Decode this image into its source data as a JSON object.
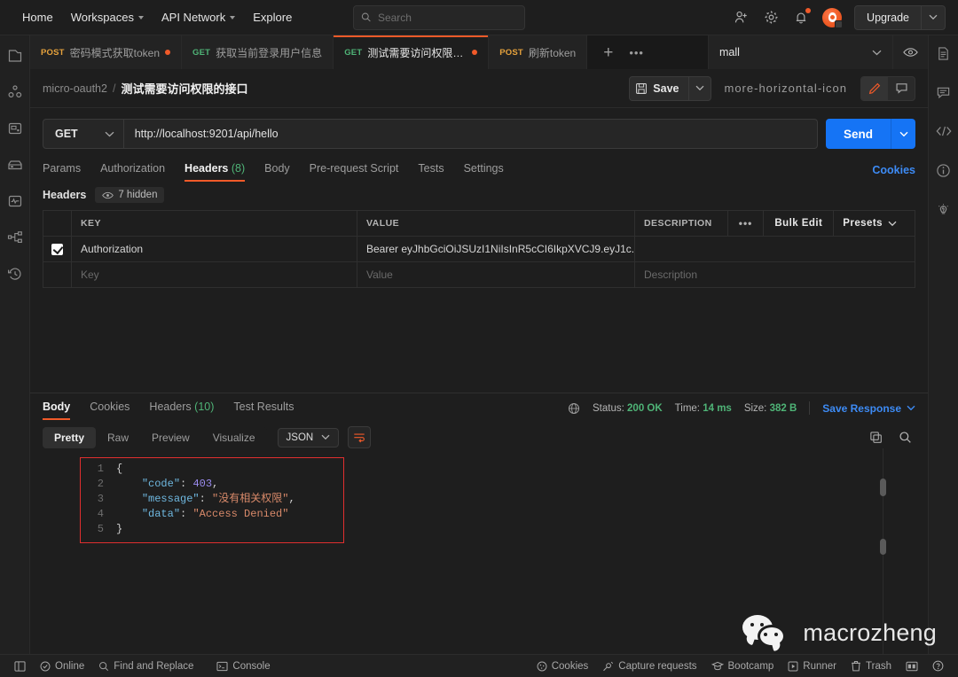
{
  "header": {
    "nav": [
      {
        "label": "Home",
        "caret": false
      },
      {
        "label": "Workspaces",
        "caret": true
      },
      {
        "label": "API Network",
        "caret": true
      },
      {
        "label": "Explore",
        "caret": false
      }
    ],
    "search": {
      "placeholder": "Search",
      "value": "",
      "icon": "search-icon"
    },
    "invite_icon": "invite-user-icon",
    "settings_icon": "gear-icon",
    "notifications_icon": "bell-icon",
    "avatar_icon": "postman-avatar-icon",
    "upgrade_label": "Upgrade"
  },
  "left_rail": [
    {
      "name": "collections-icon"
    },
    {
      "name": "apis-icon"
    },
    {
      "name": "environments-icon"
    },
    {
      "name": "mock-servers-icon"
    },
    {
      "name": "monitors-icon"
    },
    {
      "name": "flows-icon"
    },
    {
      "name": "history-icon"
    }
  ],
  "right_rail": [
    {
      "name": "documentation-icon"
    },
    {
      "name": "comments-icon"
    },
    {
      "name": "code-snippet-icon"
    },
    {
      "name": "info-icon"
    },
    {
      "name": "lightbulb-icon"
    }
  ],
  "tabs": [
    {
      "method": "POST",
      "name": "密码模式获取token",
      "unsaved": true,
      "active": false
    },
    {
      "method": "GET",
      "name": "获取当前登录用户信息",
      "unsaved": false,
      "active": false
    },
    {
      "method": "GET",
      "name": "测试需要访问权限的接口",
      "unsaved": true,
      "active": true
    },
    {
      "method": "POST",
      "name": "刷新token",
      "unsaved": false,
      "active": false
    }
  ],
  "tab_actions": {
    "new_tab": "+",
    "more": "•••"
  },
  "environment": {
    "name": "mall",
    "eye_icon": "eye-icon",
    "chevron": "chevron-down-icon"
  },
  "breadcrumb": {
    "collection": "micro-oauth2",
    "separator": "/",
    "request": "测试需要访问权限的接口"
  },
  "request_actions": {
    "save_label": "Save",
    "save_icon": "floppy-disk-icon",
    "more_icon": "more-horizontal-icon",
    "edit_icon": "pencil-icon",
    "comment_icon": "comment-icon"
  },
  "request": {
    "method": "GET",
    "url": "http://localhost:9201/api/hello",
    "send_label": "Send",
    "tabs": [
      {
        "label": "Params",
        "count": "",
        "active": false
      },
      {
        "label": "Authorization",
        "count": "",
        "active": false
      },
      {
        "label": "Headers",
        "count": "(8)",
        "active": true
      },
      {
        "label": "Body",
        "count": "",
        "active": false
      },
      {
        "label": "Pre-request Script",
        "count": "",
        "active": false
      },
      {
        "label": "Tests",
        "count": "",
        "active": false
      },
      {
        "label": "Settings",
        "count": "",
        "active": false
      }
    ],
    "cookies_link": "Cookies"
  },
  "headers_panel": {
    "title": "Headers",
    "hidden_label": "7 hidden",
    "hidden_icon": "eye-icon",
    "columns": [
      "KEY",
      "VALUE",
      "DESCRIPTION"
    ],
    "toolbar": {
      "dots": "•••",
      "bulk_edit": "Bulk Edit",
      "presets": "Presets"
    },
    "rows": [
      {
        "enabled": true,
        "key": "Authorization",
        "value": "Bearer eyJhbGciOiJSUzI1NiIsInR5cCI6IkpXVCJ9.eyJ1c...",
        "description": ""
      }
    ],
    "placeholder_row": {
      "key": "Key",
      "value": "Value",
      "description": "Description"
    }
  },
  "response": {
    "tabs": [
      {
        "label": "Body",
        "count": "",
        "active": true
      },
      {
        "label": "Cookies",
        "count": "",
        "active": false
      },
      {
        "label": "Headers",
        "count": "(10)",
        "active": false
      },
      {
        "label": "Test Results",
        "count": "",
        "active": false
      }
    ],
    "meta": {
      "globe_icon": "globe-icon",
      "status_label": "Status:",
      "status_value": "200 OK",
      "time_label": "Time:",
      "time_value": "14 ms",
      "size_label": "Size:",
      "size_value": "382 B",
      "save_response": "Save Response"
    },
    "view_modes": [
      "Pretty",
      "Raw",
      "Preview",
      "Visualize"
    ],
    "active_view": "Pretty",
    "language": "JSON",
    "wrap_icon": "wrap-lines-icon",
    "copy_icon": "copy-icon",
    "search_icon": "search-icon",
    "body_lines": [
      {
        "n": "1",
        "tokens": [
          {
            "t": "pun",
            "v": "{"
          }
        ]
      },
      {
        "n": "2",
        "tokens": [
          {
            "t": "pun",
            "v": "    "
          },
          {
            "t": "key",
            "v": "\"code\""
          },
          {
            "t": "pun",
            "v": ": "
          },
          {
            "t": "num",
            "v": "403"
          },
          {
            "t": "pun",
            "v": ","
          }
        ]
      },
      {
        "n": "3",
        "tokens": [
          {
            "t": "pun",
            "v": "    "
          },
          {
            "t": "key",
            "v": "\"message\""
          },
          {
            "t": "pun",
            "v": ": "
          },
          {
            "t": "str",
            "v": "\"没有相关权限\""
          },
          {
            "t": "pun",
            "v": ","
          }
        ]
      },
      {
        "n": "4",
        "tokens": [
          {
            "t": "pun",
            "v": "    "
          },
          {
            "t": "key",
            "v": "\"data\""
          },
          {
            "t": "pun",
            "v": ": "
          },
          {
            "t": "str",
            "v": "\"Access Denied\""
          }
        ]
      },
      {
        "n": "5",
        "tokens": [
          {
            "t": "pun",
            "v": "}"
          }
        ]
      }
    ],
    "body_json": {
      "code": 403,
      "message": "没有相关权限",
      "data": "Access Denied"
    },
    "highlight_color": "#e02f2f"
  },
  "watermark": {
    "text": "macrozheng",
    "icon": "wechat-icon"
  },
  "footer": {
    "left": [
      {
        "label": "",
        "icon": "sidebar-toggle-icon"
      },
      {
        "label": "Online",
        "icon": "online-check-icon"
      },
      {
        "label": "Find and Replace",
        "icon": "search-icon"
      },
      {
        "label": "Console",
        "icon": "console-icon"
      }
    ],
    "right": [
      {
        "label": "Cookies",
        "icon": "cookie-icon"
      },
      {
        "label": "Capture requests",
        "icon": "satellite-icon"
      },
      {
        "label": "Bootcamp",
        "icon": "graduation-cap-icon"
      },
      {
        "label": "Runner",
        "icon": "play-icon"
      },
      {
        "label": "Trash",
        "icon": "trash-icon"
      },
      {
        "label": "",
        "icon": "layout-icon"
      },
      {
        "label": "",
        "icon": "help-icon"
      }
    ]
  },
  "colors": {
    "accent": "#f15a29",
    "link": "#3d8bf5",
    "send": "#1574f5",
    "success": "#4fb477",
    "post": "#e6a23c",
    "get": "#4fb477",
    "bg": "#1e1e1e"
  }
}
